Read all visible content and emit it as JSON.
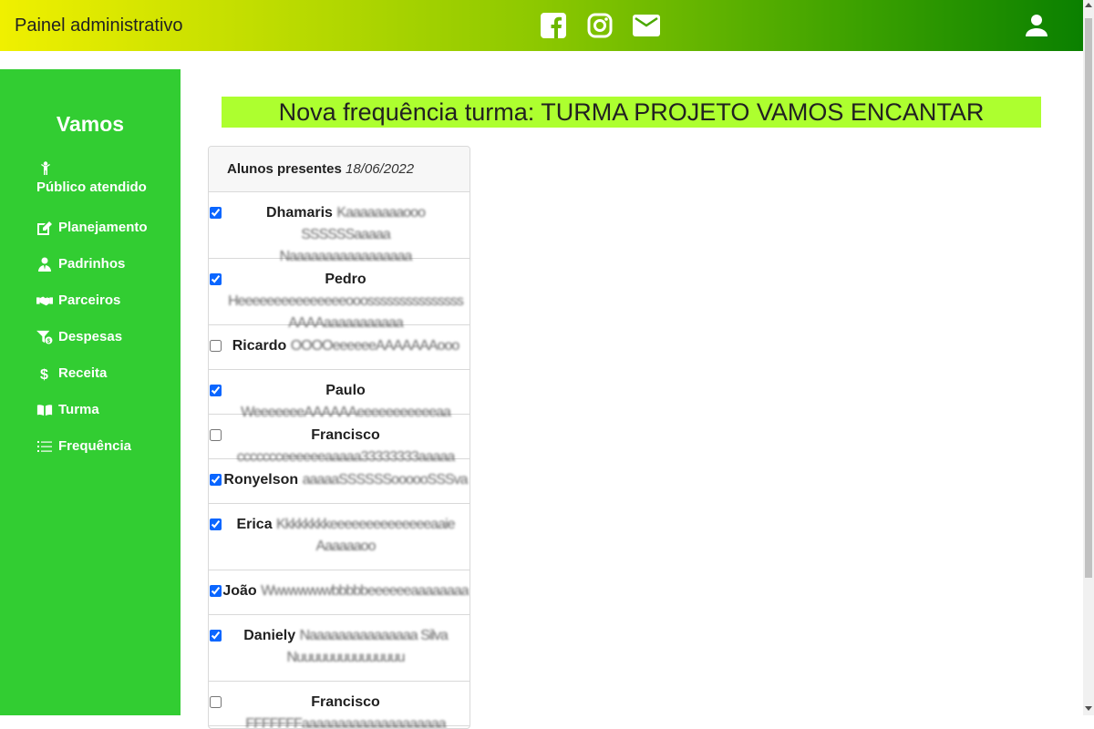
{
  "header": {
    "brand": "Painel administrativo",
    "icons": [
      "facebook-icon",
      "instagram-icon",
      "mail-icon",
      "user-icon"
    ]
  },
  "sidebar": {
    "title": "Vamos",
    "items": [
      {
        "label": "Público atendido",
        "icon": "person-icon"
      },
      {
        "label": "Planejamento",
        "icon": "edit-icon"
      },
      {
        "label": "Padrinhos",
        "icon": "user-tie-icon"
      },
      {
        "label": "Parceiros",
        "icon": "handshake-icon"
      },
      {
        "label": "Despesas",
        "icon": "funnel-dollar-icon"
      },
      {
        "label": "Receita",
        "icon": "dollar-icon"
      },
      {
        "label": "Turma",
        "icon": "book-icon"
      },
      {
        "label": "Frequência",
        "icon": "list-icon"
      }
    ]
  },
  "main": {
    "title": "Nova frequência turma: TURMA PROJETO VAMOS ENCANTAR",
    "card_header_label": "Alunos presentes",
    "card_header_date": "18/06/2022",
    "students": [
      {
        "first": "Dhamaris",
        "rest": "Kaaaaaaaaooo SSSSSSaaaaa",
        "line2": "Naaaaaaaaaaaaaaaaa",
        "checked": true
      },
      {
        "first": "Pedro",
        "rest": "Heeeeeeeeeeeeeeeooosssssssssssssss",
        "line2": "AAAAaaaaaaaaaaa",
        "checked": true
      },
      {
        "first": "Ricardo",
        "rest": "OOOOeeeeeeAAAAAAAooo",
        "line2": "",
        "checked": false
      },
      {
        "first": "Paulo",
        "rest": "WeeeeeeeAAAAAAeeeeeeeeeeeaa",
        "line2": "",
        "checked": true
      },
      {
        "first": "Francisco",
        "rest": "ccccccceeeeeeaaaaa33333333aaaaa",
        "line2": "",
        "checked": false
      },
      {
        "first": "Ronyelson",
        "rest": "aaaaaSSSSSSoooooSSSva",
        "line2": "",
        "checked": true
      },
      {
        "first": "Erica",
        "rest": "Kkkkkkkkeeeeeeeeeeeeeeaaie",
        "line2": "Aaaaaaoo",
        "checked": true
      },
      {
        "first": "João",
        "rest": "Wwwwwwwbbbbbeeeeeeaaaaaaaa",
        "line2": "",
        "checked": true
      },
      {
        "first": "Daniely",
        "rest": "Naaaaaaaaaaaaaaa Silva",
        "line2": "Nuuuuuuuuuuuuuuu",
        "checked": true
      },
      {
        "first": "Francisco",
        "rest": "FFFFFFFaaaaaaaaaaaaaaaaaaaa",
        "line2": "",
        "checked": false
      }
    ]
  },
  "colors": {
    "sidebar": "#32cd32",
    "title_bar": "#adff2f",
    "accent": "#0a66ff"
  }
}
